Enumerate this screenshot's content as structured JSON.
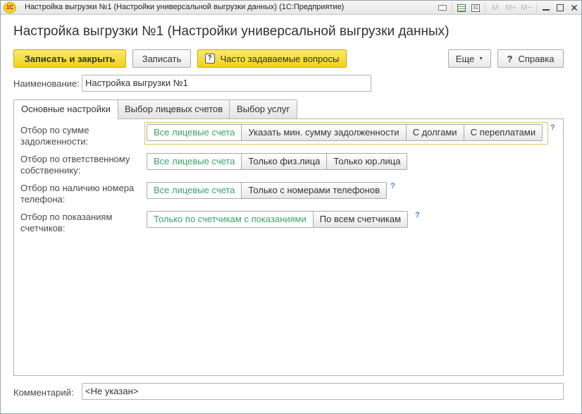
{
  "window": {
    "title": "Настройка выгрузки №1 (Настройки универсальной выгрузки данных)  (1С:Предприятие)",
    "logo_text": "1С",
    "toolbar": {
      "m": "M",
      "m_plus": "M+",
      "m_minus": "M−",
      "calendar_day": "31"
    }
  },
  "page_title": "Настройка выгрузки №1 (Настройки универсальной выгрузки данных)",
  "command_bar": {
    "save_close": "Записать и закрыть",
    "save": "Записать",
    "faq": "Часто задаваемые вопросы",
    "faq_icon": "?",
    "more": "Еще",
    "help": "Справка",
    "help_icon": "?"
  },
  "name_field": {
    "label": "Наименование:",
    "value": "Настройка выгрузки №1"
  },
  "tabs": [
    {
      "label": "Основные настройки",
      "active": true
    },
    {
      "label": "Выбор лицевых счетов",
      "active": false
    },
    {
      "label": "Выбор услуг",
      "active": false
    }
  ],
  "filters": [
    {
      "label": "Отбор по сумме задолженности:",
      "options": [
        "Все лицевые счета",
        "Указать мин. сумму задолженности",
        "С долгами",
        "С переплатами"
      ],
      "selected": 0,
      "help": "?"
    },
    {
      "label": "Отбор по ответственному собственнику:",
      "options": [
        "Все лицевые счета",
        "Только физ.лица",
        "Только юр.лица"
      ],
      "selected": 0,
      "help": ""
    },
    {
      "label": "Отбор по наличию номера телефона:",
      "options": [
        "Все лицевые счета",
        "Только с номерами телефонов"
      ],
      "selected": 0,
      "help": "?"
    },
    {
      "label": "Отбор по показаниям счетчиков:",
      "options": [
        "Только по счетчикам с показаниями",
        "По всем счетчикам"
      ],
      "selected": 0,
      "help": "?"
    }
  ],
  "comment": {
    "label": "Комментарий:",
    "value": "<Не указан>"
  },
  "colors": {
    "accent_yellow": "#f0d31a",
    "selected_text": "#3aa36a",
    "help_blue": "#3d84c6"
  }
}
